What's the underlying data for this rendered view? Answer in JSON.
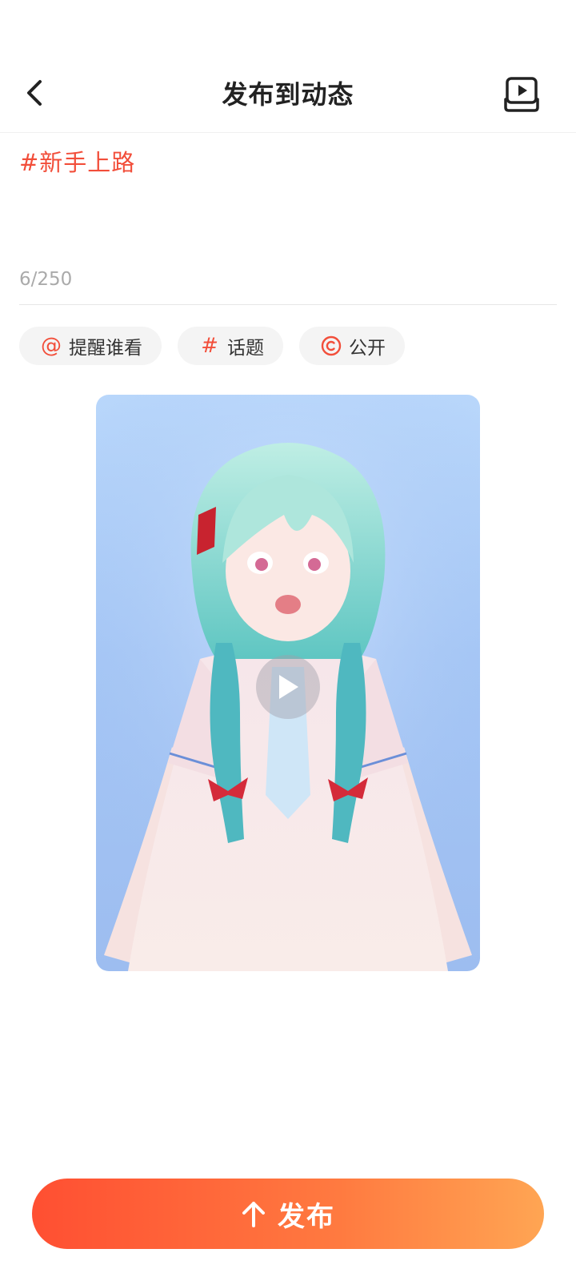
{
  "header": {
    "title": "发布到动态",
    "back_icon": "chevron-left-icon",
    "drafts_icon": "video-drafts-icon"
  },
  "editor": {
    "text": "#新手上路",
    "char_count": "6/250"
  },
  "chips": [
    {
      "icon": "at-icon",
      "glyph": "@",
      "label": "提醒谁看"
    },
    {
      "icon": "hash-icon",
      "glyph": "#",
      "label": "话题"
    },
    {
      "icon": "visibility-icon",
      "glyph": "◎",
      "label": "公开"
    }
  ],
  "media": {
    "play_icon": "play-icon"
  },
  "publish": {
    "label": "发布",
    "icon": "arrow-up-icon"
  },
  "colors": {
    "accent": "#f24e3a",
    "publish_gradient_start": "#ff4f32",
    "publish_gradient_end": "#ffa553"
  }
}
